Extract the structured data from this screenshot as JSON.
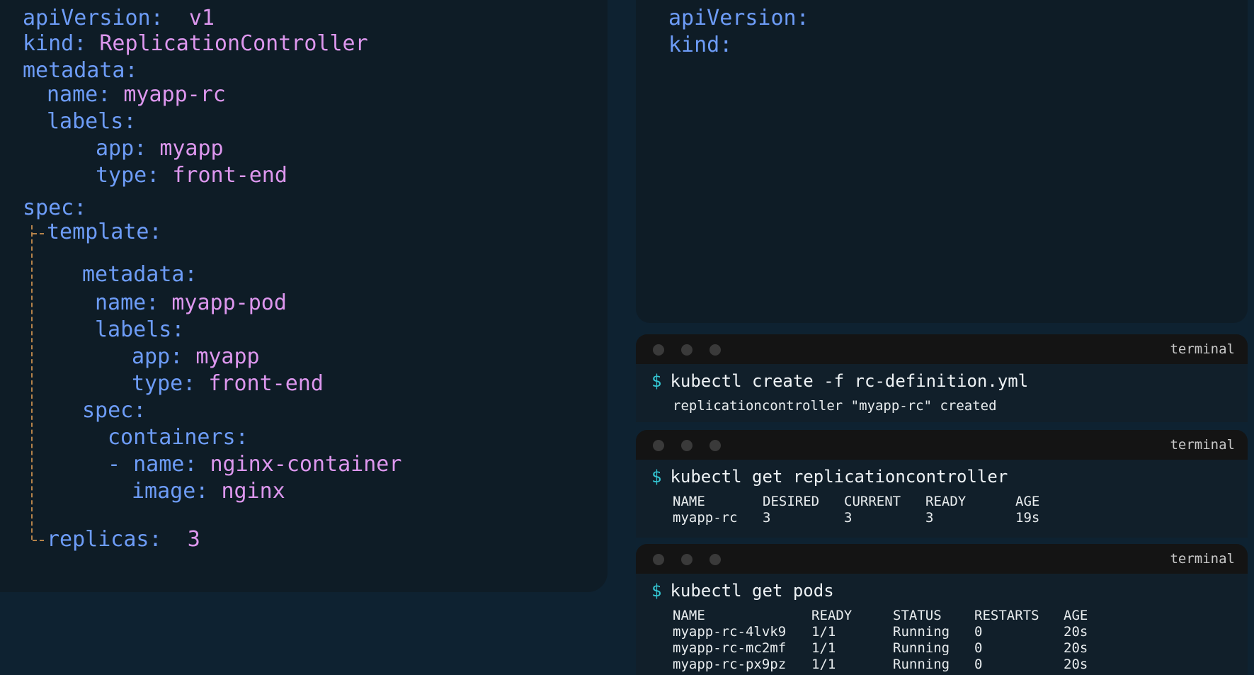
{
  "editor_left": {
    "lines": [
      {
        "key": "apiVersion:",
        "value": "v1"
      },
      {
        "key": "kind:",
        "value": "ReplicationController"
      },
      {
        "key": "metadata:"
      },
      {
        "key": "name:",
        "value": "myapp-rc"
      },
      {
        "key": "labels:"
      },
      {
        "key": "app:",
        "value": "myapp"
      },
      {
        "key": "type:",
        "value": "front-end"
      },
      {
        "key": "spec:"
      },
      {
        "key": "template:"
      },
      {
        "key": "metadata:"
      },
      {
        "key": "name:",
        "value": "myapp-pod"
      },
      {
        "key": "labels:"
      },
      {
        "key": "app:",
        "value": "myapp"
      },
      {
        "key": "type:",
        "value": "front-end"
      },
      {
        "key": "spec:"
      },
      {
        "key": "containers:"
      },
      {
        "key": "- name:",
        "value": "nginx-container"
      },
      {
        "key": "image:",
        "value": "nginx"
      },
      {
        "key": "replicas:",
        "value": "3"
      }
    ]
  },
  "editor_right": {
    "lines": [
      {
        "key": "apiVersion:"
      },
      {
        "key": "kind:"
      }
    ]
  },
  "terminals": [
    {
      "title": "terminal",
      "prompt": "$",
      "command": "kubectl create -f rc-definition.yml",
      "output": "replicationcontroller \"myapp-rc\" created"
    },
    {
      "title": "terminal",
      "prompt": "$",
      "command": "kubectl get replicationcontroller",
      "table": {
        "headers": [
          "NAME",
          "DESIRED",
          "CURRENT",
          "READY",
          "AGE"
        ],
        "rows": [
          [
            "myapp-rc",
            "3",
            "3",
            "3",
            "19s"
          ]
        ]
      }
    },
    {
      "title": "terminal",
      "prompt": "$",
      "command": "kubectl get pods",
      "table": {
        "headers": [
          "NAME",
          "READY",
          "STATUS",
          "RESTARTS",
          "AGE"
        ],
        "rows": [
          [
            "myapp-rc-4lvk9",
            "1/1",
            "Running",
            "0",
            "20s"
          ],
          [
            "myapp-rc-mc2mf",
            "1/1",
            "Running",
            "0",
            "20s"
          ],
          [
            "myapp-rc-px9pz",
            "1/1",
            "Running",
            "0",
            "20s"
          ]
        ]
      }
    }
  ],
  "colors": {
    "background": "#0e2231",
    "editor_bg": "#0e1c26",
    "yaml_key": "#6d9cf7",
    "yaml_value": "#dd97ee",
    "template_guide": "#b5834a",
    "prompt": "#34c7d4",
    "terminal_bar": "#141414"
  }
}
